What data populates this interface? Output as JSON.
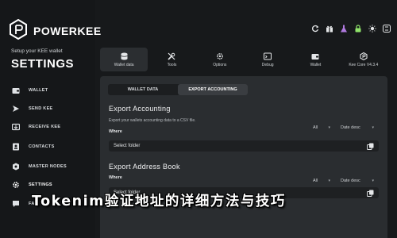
{
  "brand": {
    "name": "POWERKEE",
    "icon": "powerkee-logo"
  },
  "sidebar": {
    "subtitle": "Setup your KEE wallet",
    "title": "SETTINGS",
    "items": [
      {
        "label": "WALLET",
        "icon": "wallet-icon"
      },
      {
        "label": "SEND KEE",
        "icon": "send-icon"
      },
      {
        "label": "RECEIVE KEE",
        "icon": "receive-icon"
      },
      {
        "label": "CONTACTS",
        "icon": "contacts-icon"
      },
      {
        "label": "MASTER NODES",
        "icon": "master-nodes-icon"
      },
      {
        "label": "SETTINGS",
        "icon": "gear-icon"
      },
      {
        "label": "FAQ",
        "icon": "faq-icon"
      }
    ]
  },
  "toolbar": {
    "tabs": [
      {
        "label": "Wallet data",
        "icon": "database-icon"
      },
      {
        "label": "Tools",
        "icon": "tools-icon"
      },
      {
        "label": "Options",
        "icon": "options-icon"
      },
      {
        "label": "Debug",
        "icon": "debug-icon"
      },
      {
        "label": "Wallet",
        "icon": "wallet-icon"
      },
      {
        "label": "Kee Core V4.3.4",
        "icon": "kee-core-icon"
      }
    ]
  },
  "subtabs": [
    "WALLET DATA",
    "EXPORT ACCOUNTING"
  ],
  "export_accounting": {
    "title": "Export Accounting",
    "desc": "Export your wallets accounting data to a CSV file.",
    "where_label": "Where",
    "filter": "All",
    "sort": "Date desc",
    "folder": "Select folder"
  },
  "export_address": {
    "title": "Export Address Book",
    "where_label": "Where",
    "filter": "All",
    "sort": "Date desc",
    "folder": "Select folder"
  },
  "caption": "Tokenim验证地址的详细方法与技巧",
  "colors": {
    "background": "#17191b",
    "panel": "#2a2d30",
    "accent_green": "#8fe36a"
  }
}
